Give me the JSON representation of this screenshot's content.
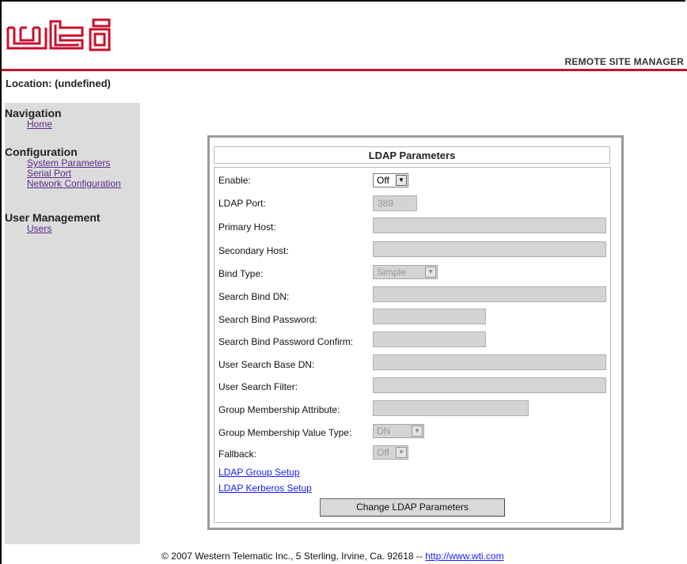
{
  "header": {
    "logo_text": "wti",
    "site_title": "REMOTE SITE MANAGER",
    "location": "Location: (undefined)"
  },
  "sidebar": {
    "sections": [
      {
        "heading": "Navigation",
        "items": [
          "Home"
        ]
      },
      {
        "heading": "Configuration",
        "items": [
          "System Parameters",
          "Serial Port",
          "Network Configuration"
        ]
      },
      {
        "heading": "User Management",
        "items": [
          "Users"
        ]
      }
    ]
  },
  "panel": {
    "title": "LDAP Parameters",
    "fields": {
      "enable": {
        "label": "Enable:",
        "value": "Off"
      },
      "ldap_port": {
        "label": "LDAP Port:",
        "value": "389"
      },
      "primary_host": {
        "label": "Primary Host:",
        "value": ""
      },
      "secondary_host": {
        "label": "Secondary Host:",
        "value": ""
      },
      "bind_type": {
        "label": "Bind Type:",
        "value": "Simple"
      },
      "search_bind_dn": {
        "label": "Search Bind DN:",
        "value": ""
      },
      "search_bind_password": {
        "label": "Search Bind Password:",
        "value": ""
      },
      "search_bind_password_confirm": {
        "label": "Search Bind Password Confirm:",
        "value": ""
      },
      "user_search_base_dn": {
        "label": "User Search Base DN:",
        "value": ""
      },
      "user_search_filter": {
        "label": "User Search Filter:",
        "value": ""
      },
      "group_membership_attribute": {
        "label": "Group Membership Attribute:",
        "value": ""
      },
      "group_membership_value_type": {
        "label": "Group Membership Value Type:",
        "value": "DN"
      },
      "fallback": {
        "label": "Fallback:",
        "value": "Off"
      }
    },
    "links": {
      "ldap_group_setup": "LDAP Group Setup",
      "ldap_kerberos_setup": "LDAP Kerberos Setup"
    },
    "submit_label": "Change LDAP Parameters"
  },
  "footer": {
    "copyright": "© 2007 Western Telematic Inc., 5 Sterling, Irvine, Ca. 92618 -- ",
    "link": "http://www.wti.com"
  },
  "colors": {
    "brand_red": "#c8102e",
    "sidebar_bg": "#dcdcdc",
    "disabled_field": "#d4d4d4",
    "link_blue": "#1a1aff",
    "visited_link": "#5b2a8a"
  },
  "icons": {
    "select_arrow": "chevron-down-icon"
  }
}
